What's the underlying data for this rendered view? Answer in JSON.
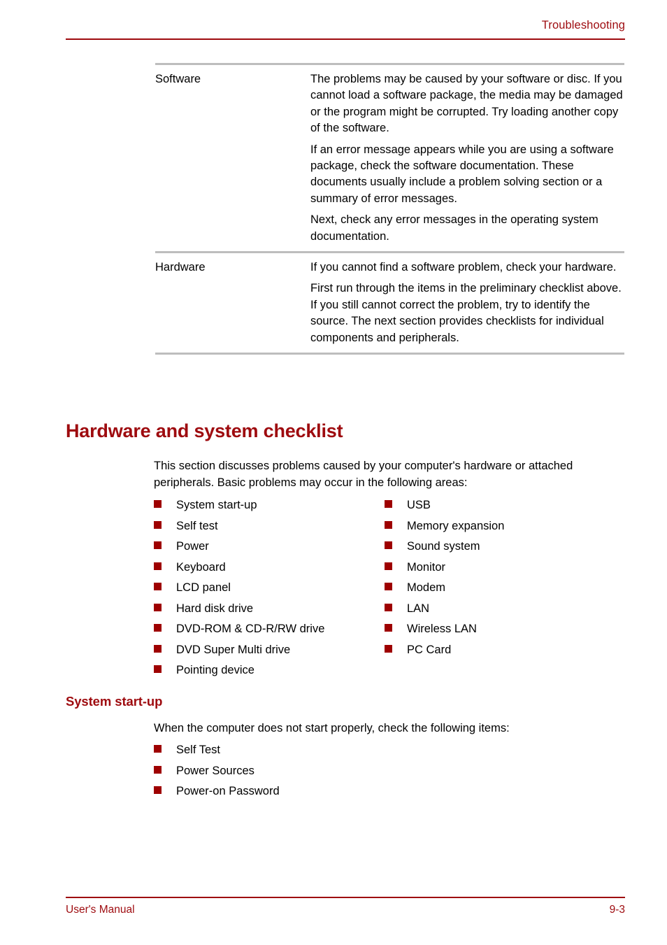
{
  "header": {
    "title": "Troubleshooting",
    "rule_color": "#9e0b0f"
  },
  "table": {
    "rule_color": "#bdbdbd",
    "rows": [
      {
        "label": "Software",
        "paragraphs": [
          "The problems may be caused by your software or disc. If you cannot load a software package, the media may be damaged or the program might be corrupted. Try loading another copy of the software.",
          "If an error message appears while you are using a software package, check the software documentation. These documents usually include a problem solving section or a summary of error messages.",
          "Next, check any error messages in the operating system documentation."
        ]
      },
      {
        "label": "Hardware",
        "paragraphs": [
          "If you cannot find a software problem, check your hardware.",
          "First run through the items in the preliminary checklist above. If you still cannot correct the problem, try to identify the source. The next section provides checklists for individual components and peripherals."
        ]
      }
    ]
  },
  "section": {
    "heading": "Hardware and system checklist",
    "heading_color": "#9e0b0f",
    "intro": "This section discusses problems caused by your computer's hardware or attached peripherals. Basic problems may occur in the following areas:",
    "bullet_color": "#9e0000",
    "checklist_left": [
      "System start-up",
      "Self test",
      "Power",
      "Keyboard",
      "LCD panel",
      "Hard disk drive",
      "DVD-ROM & CD-R/RW drive",
      "DVD Super Multi drive",
      "Pointing device"
    ],
    "checklist_right": [
      "USB",
      "Memory expansion",
      "Sound system",
      "Monitor",
      "Modem",
      "LAN",
      "Wireless LAN",
      "PC Card"
    ]
  },
  "subsection": {
    "heading": "System start-up",
    "intro": "When the computer does not start properly, check the following items:",
    "items": [
      "Self Test",
      "Power Sources",
      "Power-on Password"
    ]
  },
  "footer": {
    "left": "User's Manual",
    "right": "9-3",
    "rule_color": "#9e0b0f"
  }
}
